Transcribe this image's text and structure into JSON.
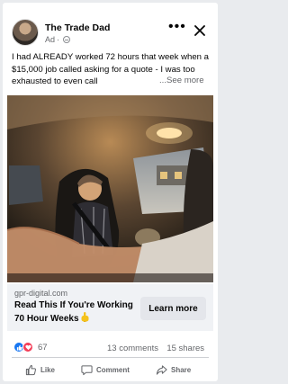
{
  "post": {
    "page_name": "The Trade Dad",
    "sponsored_label": "Ad",
    "caption": "I had ALREADY worked 72 hours that week when a $15,000 job called asking for a quote - I was too exhausted to even call",
    "see_more": "...See more"
  },
  "link": {
    "domain": "gpr-digital.com",
    "headline": "Read This If You're Working 70 Hour Weeks",
    "cta": "Learn more"
  },
  "engagement": {
    "reaction_count": "67",
    "comments": "13 comments",
    "shares": "15 shares"
  },
  "actions": {
    "like": "Like",
    "comment": "Comment",
    "share": "Share"
  },
  "colors": {
    "like_blue": "#1877f2",
    "love_red": "#f33e58",
    "secondary_text": "#65676b"
  }
}
